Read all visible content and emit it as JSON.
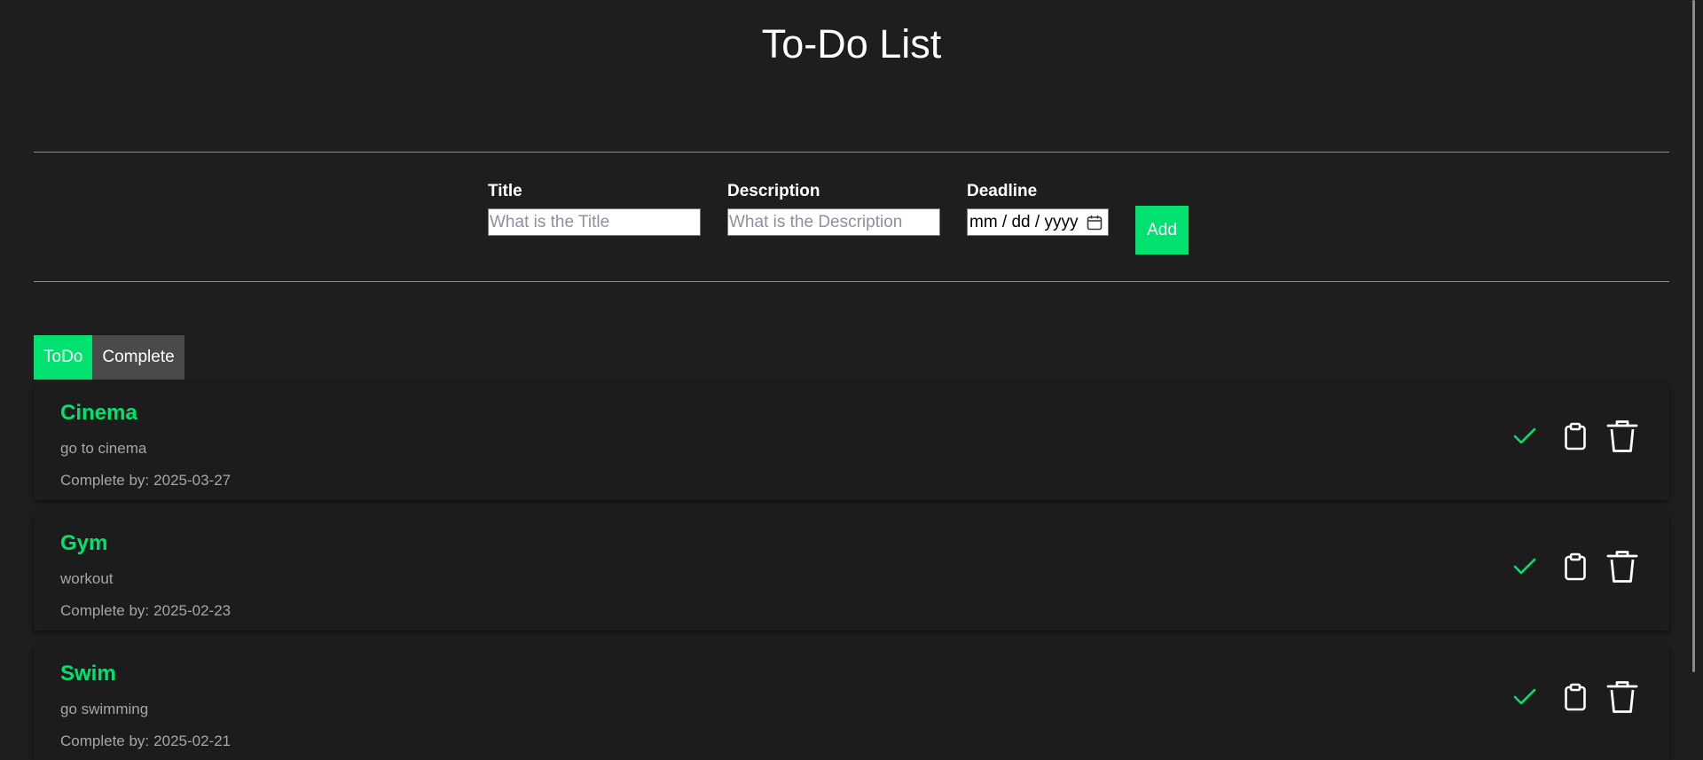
{
  "header": {
    "title": "To-Do List"
  },
  "form": {
    "title_label": "Title",
    "title_placeholder": "What is the Title",
    "description_label": "Description",
    "description_placeholder": "What is the Description",
    "deadline_label": "Deadline",
    "deadline_placeholder": "mm / dd / yyyy",
    "add_label": "Add"
  },
  "tabs": [
    {
      "label": "ToDo",
      "active": true
    },
    {
      "label": "Complete",
      "active": false
    }
  ],
  "todos": [
    {
      "title": "Cinema",
      "description": "go to cinema",
      "deadline_label": "Complete by:",
      "deadline": "2025-03-27"
    },
    {
      "title": "Gym",
      "description": "workout",
      "deadline_label": "Complete by:",
      "deadline": "2025-02-23"
    },
    {
      "title": "Swim",
      "description": "go swimming",
      "deadline_label": "Complete by:",
      "deadline": "2025-02-21"
    }
  ],
  "icons": {
    "complete": "check-icon",
    "edit": "clipboard-icon",
    "delete": "trash-icon",
    "deadline_picker": "calendar-icon"
  },
  "colors": {
    "background": "#1e1e1e",
    "accent": "#00e16f",
    "tab_inactive": "#4a4a4a",
    "muted_text": "#a6a6a6"
  }
}
